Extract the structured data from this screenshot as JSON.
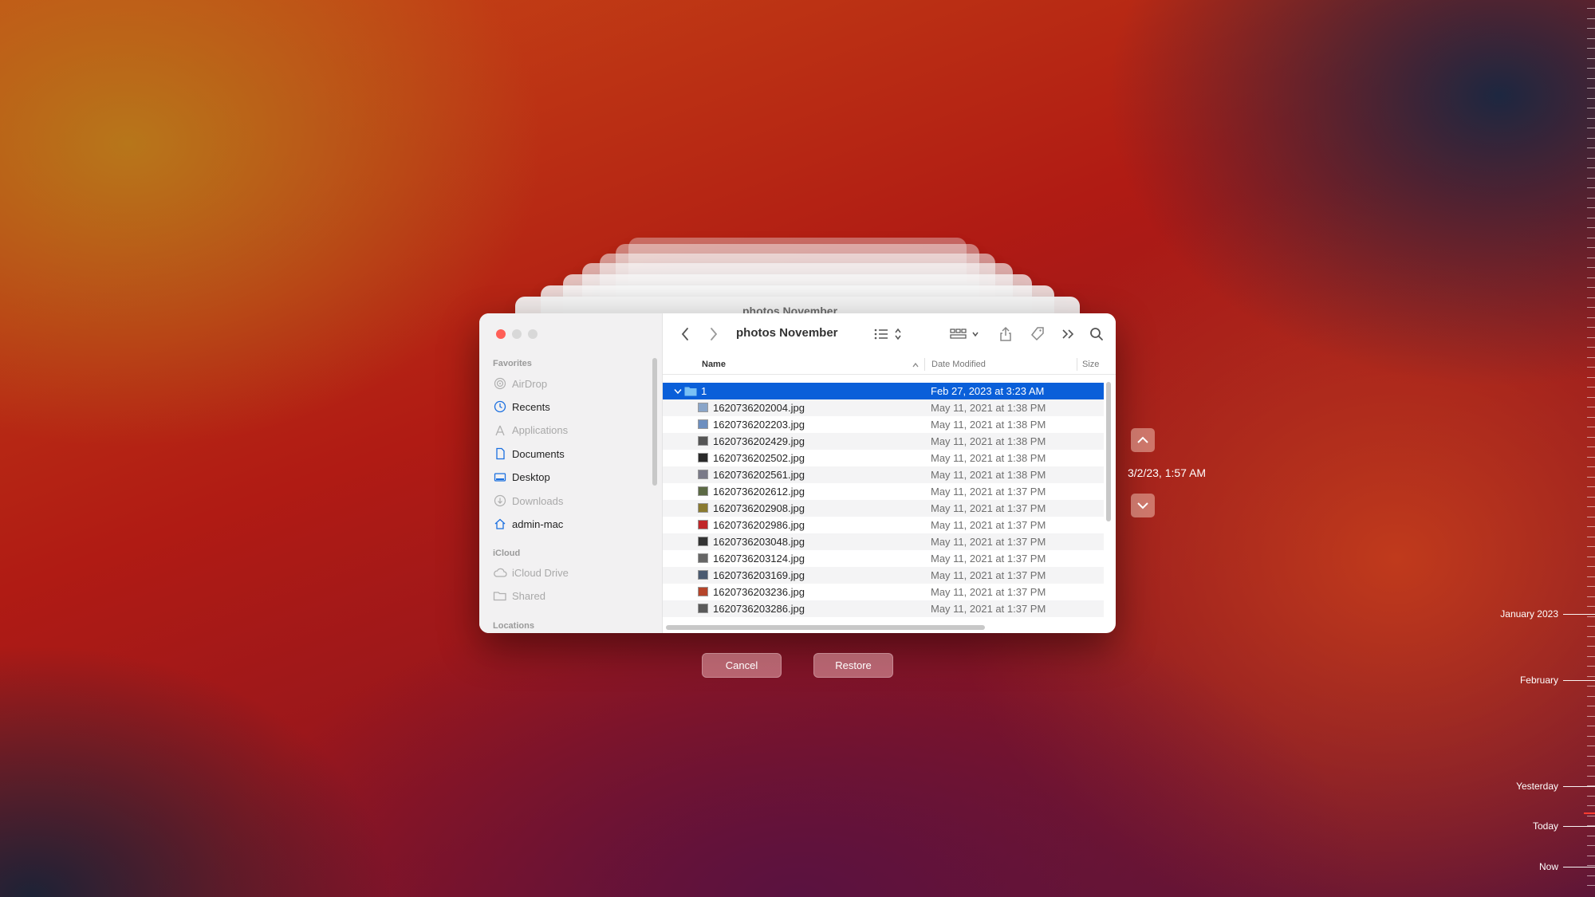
{
  "finder": {
    "title": "photos November",
    "sidebar": {
      "favorites_label": "Favorites",
      "favorites": [
        {
          "label": "AirDrop",
          "icon": "airdrop-icon",
          "dim": true
        },
        {
          "label": "Recents",
          "icon": "clock-icon",
          "dim": false
        },
        {
          "label": "Applications",
          "icon": "applications-icon",
          "dim": true
        },
        {
          "label": "Documents",
          "icon": "document-icon",
          "dim": false
        },
        {
          "label": "Desktop",
          "icon": "desktop-icon",
          "dim": false
        },
        {
          "label": "Downloads",
          "icon": "download-icon",
          "dim": true
        },
        {
          "label": "admin-mac",
          "icon": "home-icon",
          "dim": false
        }
      ],
      "icloud_label": "iCloud",
      "icloud": [
        {
          "label": "iCloud Drive",
          "icon": "cloud-icon",
          "dim": true
        },
        {
          "label": "Shared",
          "icon": "shared-folder-icon",
          "dim": true
        }
      ],
      "locations_label": "Locations"
    },
    "columns": {
      "name": "Name",
      "date": "Date Modified",
      "size": "Size"
    },
    "rows": [
      {
        "name": "1",
        "date": "Feb 27, 2023 at 3:23 AM",
        "folder": true,
        "selected": true
      },
      {
        "name": "1620736202004.jpg",
        "date": "May 11, 2021 at 1:38 PM",
        "thumb": "#8aa5c8"
      },
      {
        "name": "1620736202203.jpg",
        "date": "May 11, 2021 at 1:38 PM",
        "thumb": "#6d8fbf"
      },
      {
        "name": "1620736202429.jpg",
        "date": "May 11, 2021 at 1:38 PM",
        "thumb": "#555555"
      },
      {
        "name": "1620736202502.jpg",
        "date": "May 11, 2021 at 1:38 PM",
        "thumb": "#2a2a2a"
      },
      {
        "name": "1620736202561.jpg",
        "date": "May 11, 2021 at 1:38 PM",
        "thumb": "#7a7a88"
      },
      {
        "name": "1620736202612.jpg",
        "date": "May 11, 2021 at 1:37 PM",
        "thumb": "#5c6a45"
      },
      {
        "name": "1620736202908.jpg",
        "date": "May 11, 2021 at 1:37 PM",
        "thumb": "#8a7a30"
      },
      {
        "name": "1620736202986.jpg",
        "date": "May 11, 2021 at 1:37 PM",
        "thumb": "#c0282a"
      },
      {
        "name": "1620736203048.jpg",
        "date": "May 11, 2021 at 1:37 PM",
        "thumb": "#333333"
      },
      {
        "name": "1620736203124.jpg",
        "date": "May 11, 2021 at 1:37 PM",
        "thumb": "#666666"
      },
      {
        "name": "1620736203169.jpg",
        "date": "May 11, 2021 at 1:37 PM",
        "thumb": "#4a5a70"
      },
      {
        "name": "1620736203236.jpg",
        "date": "May 11, 2021 at 1:37 PM",
        "thumb": "#b5452a"
      },
      {
        "name": "1620736203286.jpg",
        "date": "May 11, 2021 at 1:37 PM",
        "thumb": "#5a5a5a"
      }
    ]
  },
  "time_machine": {
    "current_date": "3/2/23, 1:57 AM",
    "cancel_label": "Cancel",
    "restore_label": "Restore",
    "timeline_labels": [
      "January 2023",
      "February",
      "Yesterday",
      "Today",
      "Now"
    ]
  },
  "colors": {
    "selection": "#0a5fd9",
    "close": "#ff5f57",
    "accent_icon": "#1a6fe0"
  }
}
